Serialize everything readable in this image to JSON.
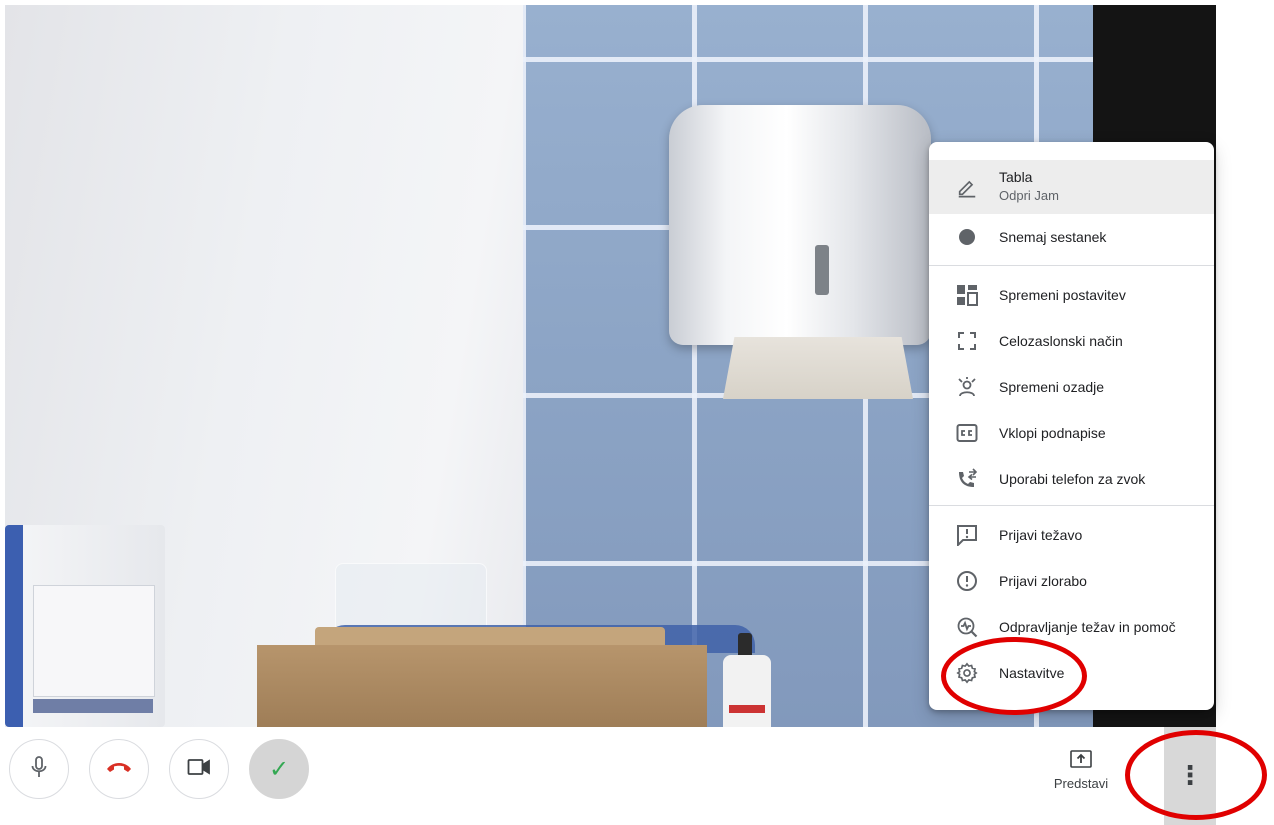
{
  "colors": {
    "accent_red": "#d93025",
    "annotation_red": "#e00000",
    "check_green": "#34a853",
    "menu_text": "#202124",
    "menu_icon": "#5f6368"
  },
  "menu": {
    "items": [
      {
        "label": "Tabla",
        "sublabel": "Odpri Jam",
        "icon": "pen-icon"
      },
      {
        "label": "Snemaj sestanek",
        "icon": "record-dot-icon"
      },
      {
        "label": "Spremeni postavitev",
        "icon": "layout-grid-icon"
      },
      {
        "label": "Celozaslonski način",
        "icon": "fullscreen-icon"
      },
      {
        "label": "Spremeni ozadje",
        "icon": "background-effects-icon"
      },
      {
        "label": "Vklopi podnapise",
        "icon": "closed-captions-icon"
      },
      {
        "label": "Uporabi telefon za zvok",
        "icon": "phone-audio-icon"
      },
      {
        "label": "Prijavi težavo",
        "icon": "feedback-icon"
      },
      {
        "label": "Prijavi zlorabo",
        "icon": "report-abuse-icon"
      },
      {
        "label": "Odpravljanje težav in pomoč",
        "icon": "troubleshoot-icon"
      },
      {
        "label": "Nastavitve",
        "icon": "gear-icon"
      }
    ]
  },
  "controls": {
    "present_label": "Predstavi",
    "more_glyph": "⋮",
    "check_glyph": "✓"
  }
}
